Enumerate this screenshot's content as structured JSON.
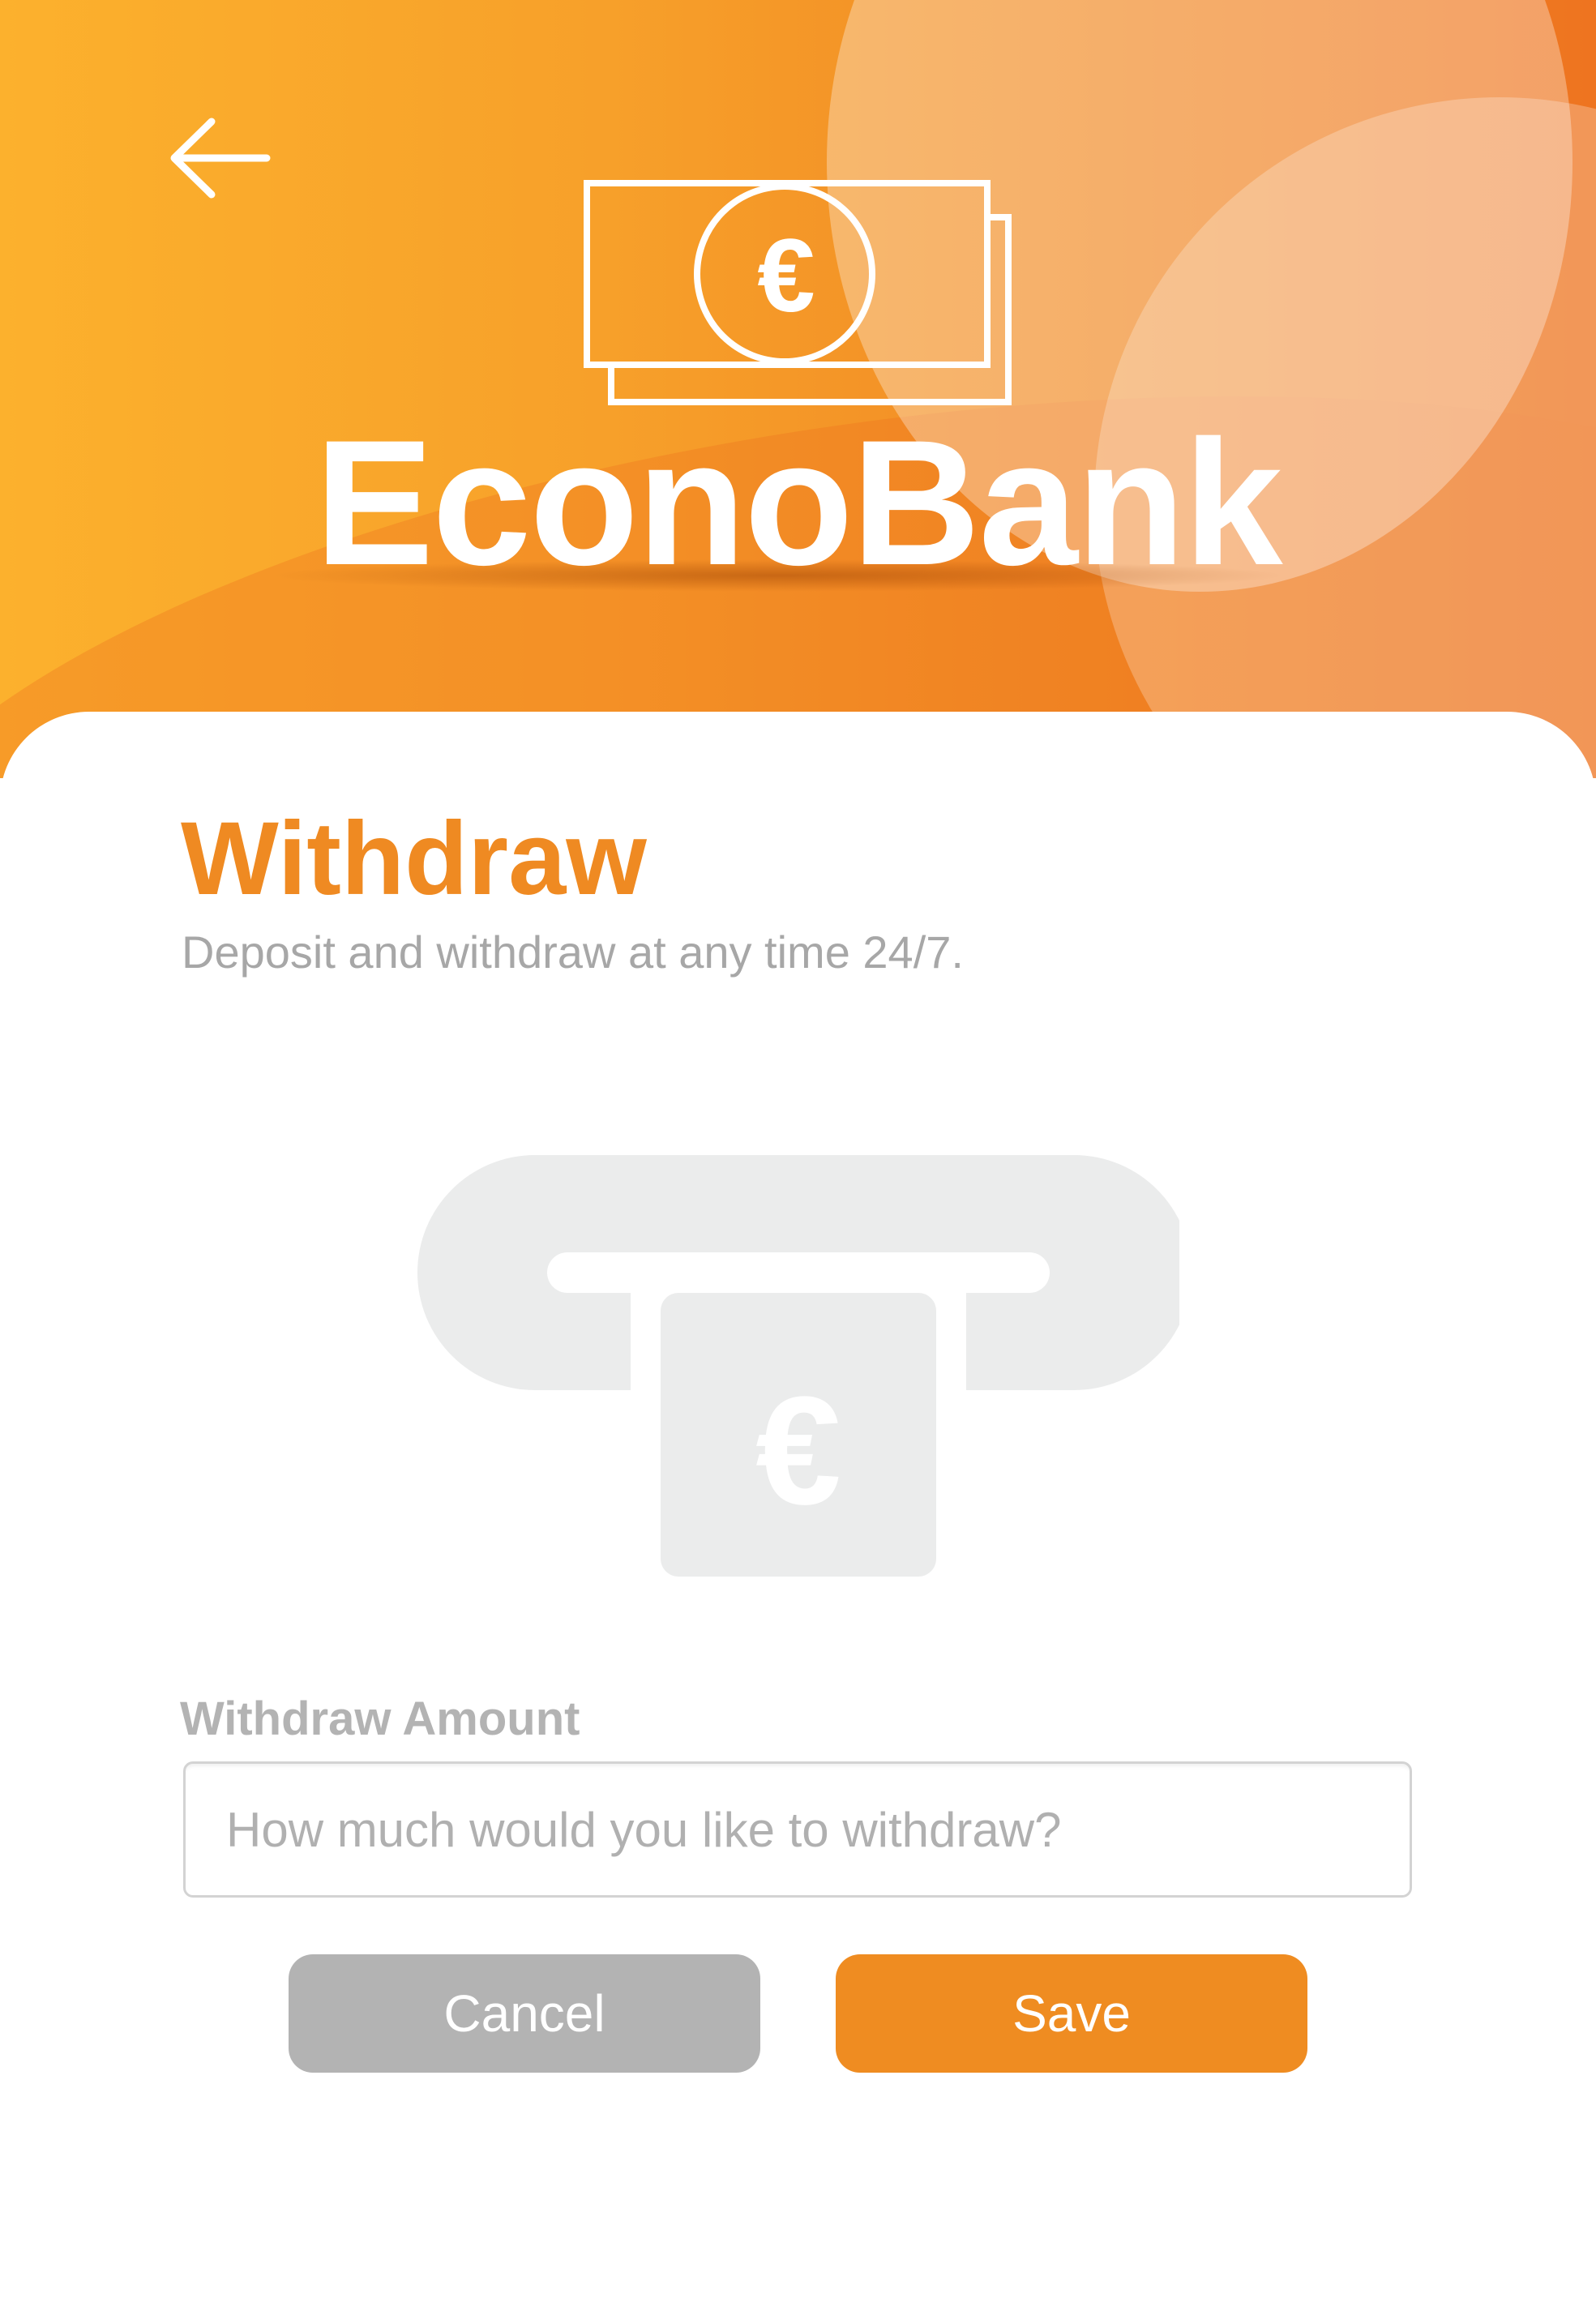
{
  "header": {
    "brand_name": "EconoBank",
    "back_icon": "arrow-left-icon",
    "logo_icon": "euro-banknote-icon",
    "logo_symbol": "€"
  },
  "main": {
    "title": "Withdraw",
    "subtitle": "Deposit and withdraw at any time 24/7.",
    "illustration_icon": "atm-withdraw-icon",
    "illustration_symbol": "€"
  },
  "form": {
    "amount_label": "Withdraw Amount",
    "amount_value": "",
    "amount_placeholder": "How much would you like to withdraw?"
  },
  "actions": {
    "cancel_label": "Cancel",
    "save_label": "Save"
  },
  "colors": {
    "accent": "#ef8c21",
    "header_gradient_start": "#fcb12d",
    "header_gradient_end": "#ee7420",
    "cancel_button": "#b3b3b3",
    "muted_text": "#a7a7a7",
    "illustration_gray": "#ebecec"
  }
}
